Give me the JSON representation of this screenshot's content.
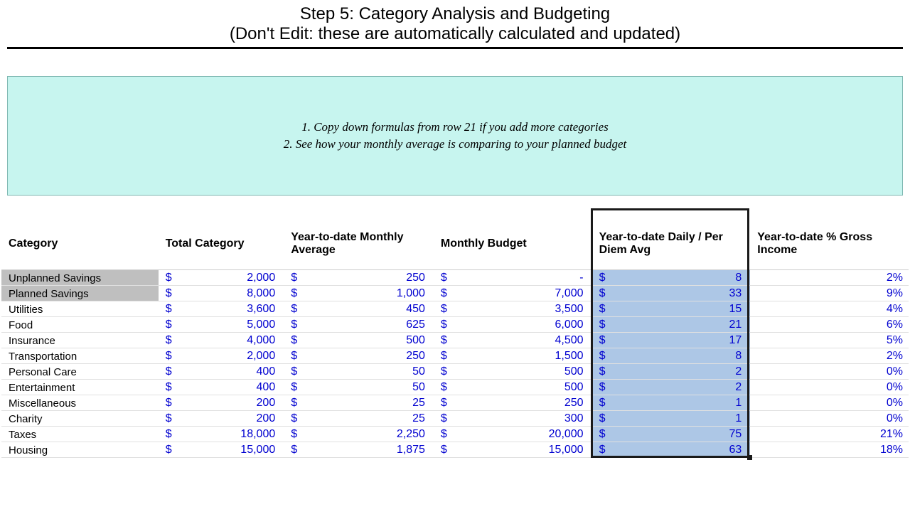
{
  "title": {
    "line1": "Step 5: Category Analysis and Budgeting",
    "line2": "(Don't Edit: these are automatically calculated and updated)"
  },
  "notes": {
    "line1": "1. Copy down formulas from row 21 if you add more categories",
    "line2": "2. See how your monthly average is comparing to your planned budget"
  },
  "columns": {
    "c1": "Category",
    "c2": "Total Category",
    "c3": "Year-to-date Monthly Average",
    "c4": "Monthly Budget",
    "c5": "Year-to-date Daily / Per Diem Avg",
    "c6": "Year-to-date % Gross Income"
  },
  "currency": "$",
  "rows": [
    {
      "shaded": true,
      "category": "Unplanned Savings",
      "total": "2,000",
      "ytd_monthly": "250",
      "monthly_budget": "-",
      "per_diem": "8",
      "pct": "2%"
    },
    {
      "shaded": true,
      "category": "Planned Savings",
      "total": "8,000",
      "ytd_monthly": "1,000",
      "monthly_budget": "7,000",
      "per_diem": "33",
      "pct": "9%"
    },
    {
      "shaded": false,
      "category": "Utilities",
      "total": "3,600",
      "ytd_monthly": "450",
      "monthly_budget": "3,500",
      "per_diem": "15",
      "pct": "4%"
    },
    {
      "shaded": false,
      "category": "Food",
      "total": "5,000",
      "ytd_monthly": "625",
      "monthly_budget": "6,000",
      "per_diem": "21",
      "pct": "6%"
    },
    {
      "shaded": false,
      "category": "Insurance",
      "total": "4,000",
      "ytd_monthly": "500",
      "monthly_budget": "4,500",
      "per_diem": "17",
      "pct": "5%"
    },
    {
      "shaded": false,
      "category": "Transportation",
      "total": "2,000",
      "ytd_monthly": "250",
      "monthly_budget": "1,500",
      "per_diem": "8",
      "pct": "2%"
    },
    {
      "shaded": false,
      "category": "Personal Care",
      "total": "400",
      "ytd_monthly": "50",
      "monthly_budget": "500",
      "per_diem": "2",
      "pct": "0%"
    },
    {
      "shaded": false,
      "category": "Entertainment",
      "total": "400",
      "ytd_monthly": "50",
      "monthly_budget": "500",
      "per_diem": "2",
      "pct": "0%"
    },
    {
      "shaded": false,
      "category": "Miscellaneous",
      "total": "200",
      "ytd_monthly": "25",
      "monthly_budget": "250",
      "per_diem": "1",
      "pct": "0%"
    },
    {
      "shaded": false,
      "category": "Charity",
      "total": "200",
      "ytd_monthly": "25",
      "monthly_budget": "300",
      "per_diem": "1",
      "pct": "0%"
    },
    {
      "shaded": false,
      "category": "Taxes",
      "total": "18,000",
      "ytd_monthly": "2,250",
      "monthly_budget": "20,000",
      "per_diem": "75",
      "pct": "21%"
    },
    {
      "shaded": false,
      "category": "Housing",
      "total": "15,000",
      "ytd_monthly": "1,875",
      "monthly_budget": "15,000",
      "per_diem": "63",
      "pct": "18%"
    }
  ],
  "selection": {
    "col": 5,
    "includes_header": true,
    "row_start": 0,
    "row_end": 11
  }
}
